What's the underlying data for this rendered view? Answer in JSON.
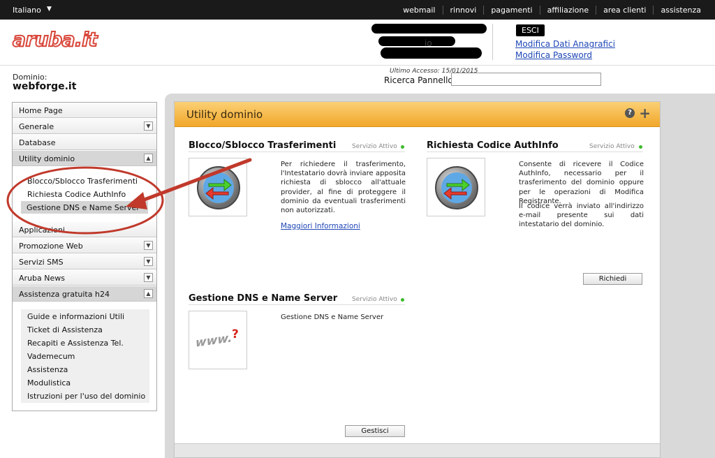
{
  "topbar": {
    "language": "Italiano",
    "nav": [
      "webmail",
      "rinnovi",
      "pagamenti",
      "affiliazione",
      "area clienti",
      "assistenza"
    ]
  },
  "header": {
    "logo_text": "aruba.it",
    "user_partial": "io",
    "logout_label": "ESCI",
    "link_anagrafica": "Modifica Dati Anagrafici",
    "link_password": "Modifica Password"
  },
  "domain": {
    "label": "Dominio:",
    "name": "webforge.it",
    "last_access": "Ultimo Accesso: 15/01/2015",
    "search_label": "Ricerca Pannello:",
    "search_value": ""
  },
  "sidebar": {
    "items": [
      {
        "label": "Home Page"
      },
      {
        "label": "Generale"
      },
      {
        "label": "Database"
      },
      {
        "label": "Utility dominio"
      },
      {
        "label": "Applicazioni"
      },
      {
        "label": "Promozione Web"
      },
      {
        "label": "Servizi SMS"
      },
      {
        "label": "Aruba News"
      },
      {
        "label": "Assistenza gratuita h24"
      }
    ],
    "utility_sub": [
      "Blocco/Sblocco Trasferimenti",
      "Richiesta Codice AuthInfo",
      "Gestione DNS e Name Server"
    ],
    "assistenza_sub": [
      "Guide e informazioni Utili",
      "Ticket di Assistenza",
      "Recapiti e Assistenza Tel.",
      "Vademecum",
      "Assistenza",
      "Modulistica",
      "Istruzioni per l'uso del dominio"
    ]
  },
  "panel": {
    "title": "Utility dominio",
    "help_icon": "?",
    "expand_icon": "+",
    "services": [
      {
        "title": "Blocco/Sblocco Trasferimenti",
        "status": "Servizio Attivo",
        "description": "Per richiedere il trasferimento, l'Intestatario dovrà inviare apposita richiesta di sblocco all'attuale provider, al fine di proteggere il dominio da eventuali trasferimenti non autorizzati.",
        "link": "Maggiori Informazioni"
      },
      {
        "title": "Richiesta Codice AuthInfo",
        "status": "Servizio Attivo",
        "description": "Consente di ricevere il Codice AuthInfo, necessario per il trasferimento del dominio oppure per le operazioni di Modifica Registrante.",
        "description2": "Il codice verrà inviato all'indirizzo e-mail presente sui dati intestatario del dominio.",
        "button": "Richiedi"
      },
      {
        "title": "Gestione DNS e Name Server",
        "status": "Servizio Attivo",
        "description": "Gestione DNS e Name Server",
        "thumb_text": "www.",
        "button": "Gestisci"
      }
    ]
  },
  "colors": {
    "accent_orange": "#f1a72a",
    "annotation_red": "#c0392b",
    "link_blue": "#1d46b6",
    "status_green": "#3dbb2b"
  }
}
